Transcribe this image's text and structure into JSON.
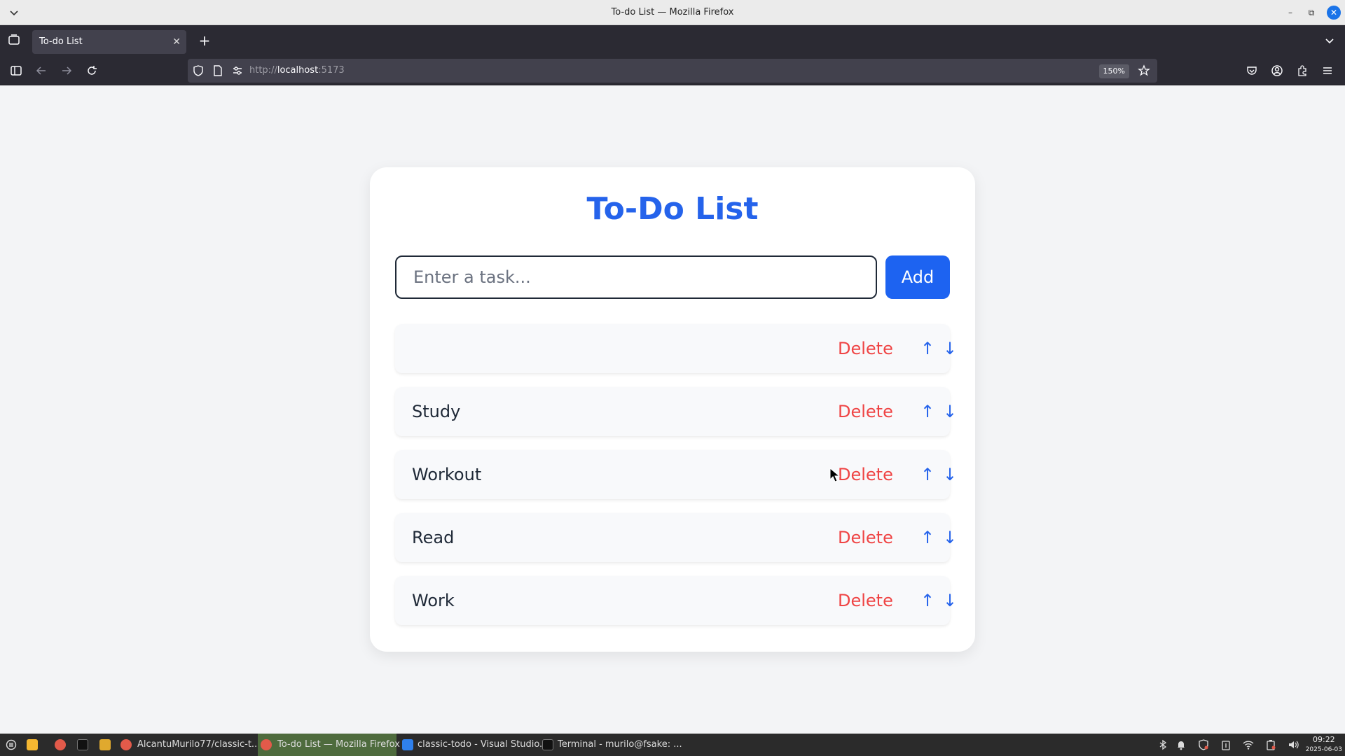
{
  "window": {
    "title": "To-do List — Mozilla Firefox"
  },
  "browser": {
    "tab_title": "To-do List",
    "url_prefix": "http://",
    "url_host": "localhost",
    "url_port": ":5173",
    "zoom": "150%"
  },
  "app": {
    "heading": "To-Do List",
    "input_placeholder": "Enter a task...",
    "input_value": "",
    "add_label": "Add",
    "tasks": [
      {
        "text": "",
        "delete_label": "Delete",
        "up": "↑",
        "down": "↓"
      },
      {
        "text": "Study",
        "delete_label": "Delete",
        "up": "↑",
        "down": "↓"
      },
      {
        "text": "Workout",
        "delete_label": "Delete",
        "up": "↑",
        "down": "↓"
      },
      {
        "text": "Read",
        "delete_label": "Delete",
        "up": "↑",
        "down": "↓"
      },
      {
        "text": "Work",
        "delete_label": "Delete",
        "up": "↑",
        "down": "↓"
      }
    ]
  },
  "taskbar": {
    "items": [
      "AlcantuMurilo77/classic-t...",
      "To-do List — Mozilla Firefox",
      "classic-todo - Visual Studio...",
      "Terminal - murilo@fsake: ..."
    ],
    "time": "09:22",
    "date": "2025-06-03"
  },
  "colors": {
    "accent": "#2563eb",
    "danger": "#ef4444",
    "page_bg": "#f3f4f6"
  }
}
